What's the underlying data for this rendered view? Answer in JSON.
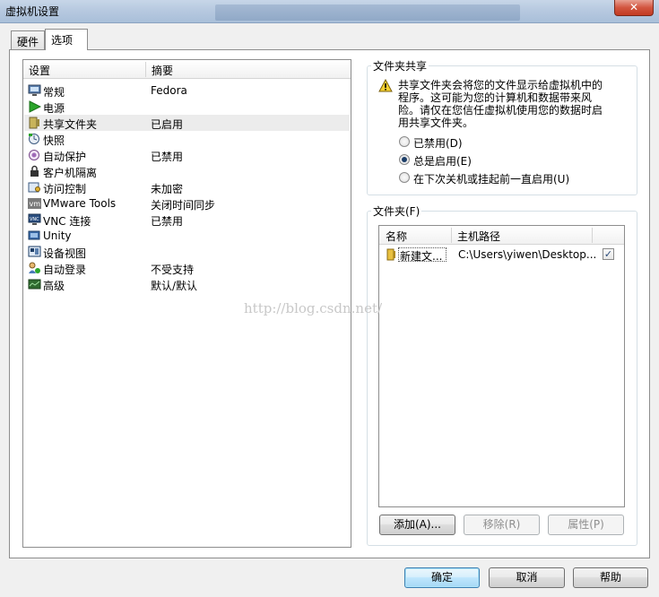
{
  "window": {
    "title": "虚拟机设置",
    "close_label": "✕"
  },
  "tabs": [
    {
      "label": "硬件",
      "active": false
    },
    {
      "label": "选项",
      "active": true
    }
  ],
  "settings_list": {
    "columns": [
      "设置",
      "摘要"
    ],
    "rows": [
      {
        "name": "常规",
        "summary": "Fedora",
        "icon": "monitor-icon"
      },
      {
        "name": "电源",
        "summary": "",
        "icon": "power-play-icon"
      },
      {
        "name": "共享文件夹",
        "summary": "已启用",
        "icon": "shared-folder-icon",
        "selected": true
      },
      {
        "name": "快照",
        "summary": "",
        "icon": "snapshot-icon"
      },
      {
        "name": "自动保护",
        "summary": "已禁用",
        "icon": "autoprotect-icon"
      },
      {
        "name": "客户机隔离",
        "summary": "",
        "icon": "lock-icon"
      },
      {
        "name": "访问控制",
        "summary": "未加密",
        "icon": "access-control-icon"
      },
      {
        "name": "VMware Tools",
        "summary": "关闭时间同步",
        "icon": "vmware-tools-icon"
      },
      {
        "name": "VNC 连接",
        "summary": "已禁用",
        "icon": "vnc-icon"
      },
      {
        "name": "Unity",
        "summary": "",
        "icon": "unity-icon"
      },
      {
        "name": "设备视图",
        "summary": "",
        "icon": "device-view-icon"
      },
      {
        "name": "自动登录",
        "summary": "不受支持",
        "icon": "autologin-icon"
      },
      {
        "name": "高级",
        "summary": "默认/默认",
        "icon": "advanced-icon"
      }
    ]
  },
  "folder_sharing": {
    "group_label": "文件夹共享",
    "warning": "共享文件夹会将您的文件显示给虚拟机中的程序。这可能为您的计算机和数据带来风险。请仅在您信任虚拟机使用您的数据时启用共享文件夹。",
    "options": [
      {
        "label": "已禁用(D)",
        "checked": false
      },
      {
        "label": "总是启用(E)",
        "checked": true
      },
      {
        "label": "在下次关机或挂起前一直启用(U)",
        "checked": false
      }
    ]
  },
  "folders": {
    "group_label": "文件夹(F)",
    "columns": [
      "名称",
      "主机路径"
    ],
    "rows": [
      {
        "name": "新建文...",
        "path": "C:\\Users\\yiwen\\Desktop...",
        "enabled": true
      }
    ],
    "add_label": "添加(A)...",
    "remove_label": "移除(R)",
    "properties_label": "属性(P)"
  },
  "footer": {
    "ok_label": "确定",
    "cancel_label": "取消",
    "help_label": "帮助"
  },
  "watermark": "http://blog.csdn.net/",
  "colors": {
    "selection": "#ececec",
    "radio_dot": "#1c3e68",
    "close": "#c23a22"
  }
}
